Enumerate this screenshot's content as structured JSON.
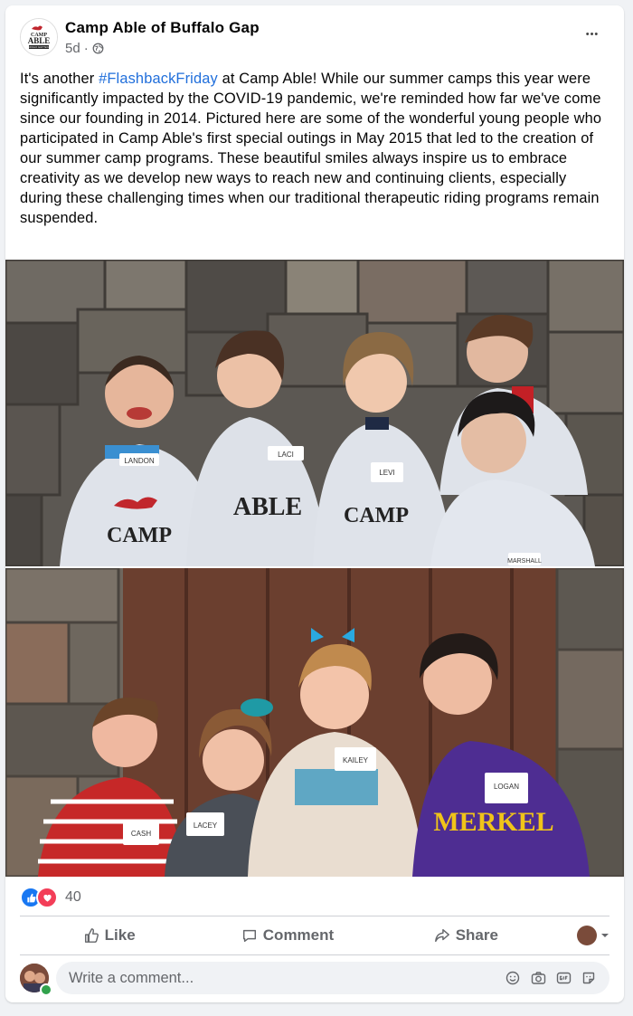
{
  "post": {
    "page_name": "Camp Able of Buffalo Gap",
    "time": "5d",
    "dot": "·",
    "more_label": "•••",
    "text_prefix": "It's another ",
    "hashtag": "#FlashbackFriday",
    "text_body": " at Camp Able! While our summer camps this year were significantly impacted by the COVID-19 pandemic, we're reminded how far we've come since our founding in 2014. Pictured here are some of the wonderful young people who participated in Camp Able's first special outings in May 2015 that led to the creation of our summer camp programs. These beautiful smiles always inspire us to embrace creativity as we develop new ways to reach new and continuing clients, especially during these challenging times when our traditional therapeutic riding programs remain suspended.",
    "logo_text": [
      "CAMP",
      "ABLE",
      "BUFFALO GAP TEXAS"
    ]
  },
  "photo1": {
    "shirt_text": [
      "CAMP",
      "ABLE"
    ],
    "name_tags": [
      "LANDON",
      "LACI",
      "LEVI",
      "MARSHALL"
    ]
  },
  "photo2": {
    "shirt_text": "MERKEL",
    "name_tags": [
      "CASH",
      "LACEY",
      "KAILEY",
      "LOGAN"
    ]
  },
  "reactions": {
    "count": "40",
    "types": [
      "like",
      "love"
    ]
  },
  "actions": {
    "like": "Like",
    "comment": "Comment",
    "share": "Share"
  },
  "comment": {
    "placeholder": "Write a comment...",
    "icons": [
      "emoji-icon",
      "camera-icon",
      "gif-icon",
      "sticker-icon"
    ]
  },
  "colors": {
    "link": "#216fdb",
    "meta": "#65676b",
    "like_blue": "#1877f2",
    "love_red": "#f33e58"
  }
}
